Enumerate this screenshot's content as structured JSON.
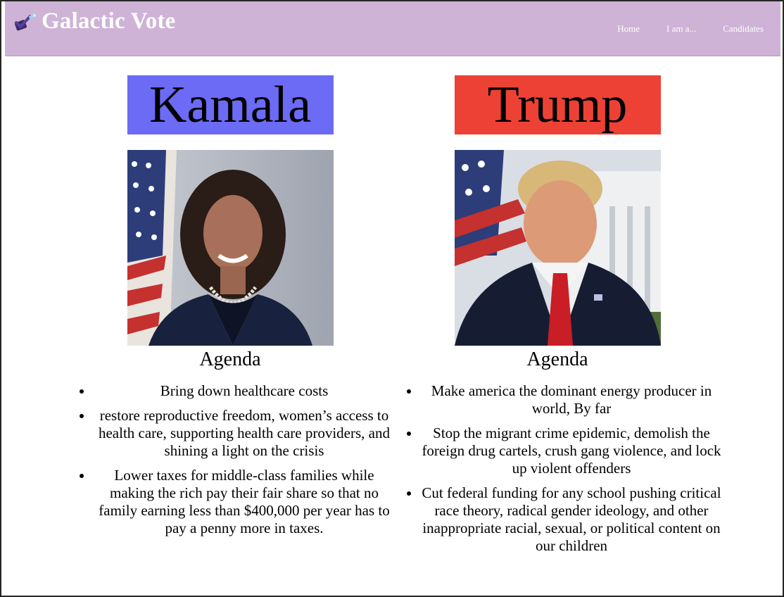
{
  "header": {
    "title": "Galactic Vote",
    "logo_icon": "ballot-check-icon",
    "nav": [
      {
        "label": "Home"
      },
      {
        "label": "I am a..."
      },
      {
        "label": "Candidates"
      }
    ]
  },
  "colors": {
    "header_bg": "#ceb3d6",
    "kamala_banner": "#6b6bf5",
    "trump_banner": "#ed4136"
  },
  "candidates": [
    {
      "name": "Kamala",
      "agenda_title": "Agenda",
      "agenda": [
        "Bring down healthcare costs",
        "restore reproductive freedom, women’s access to health care, supporting health care providers, and shining a light on the crisis",
        "Lower taxes for middle-class families while making the rich pay their fair share so that no family earning less than $400,000 per year has to pay a penny more in taxes."
      ]
    },
    {
      "name": "Trump",
      "agenda_title": "Agenda",
      "agenda": [
        "Make america the dominant energy producer in world, By far",
        "Stop the migrant crime epidemic, demolish the foreign drug cartels, crush gang violence, and lock up violent offenders",
        "Cut federal funding for any school pushing critical race theory, radical gender ideology, and other inappropriate racial, sexual, or political content on our children"
      ]
    }
  ]
}
